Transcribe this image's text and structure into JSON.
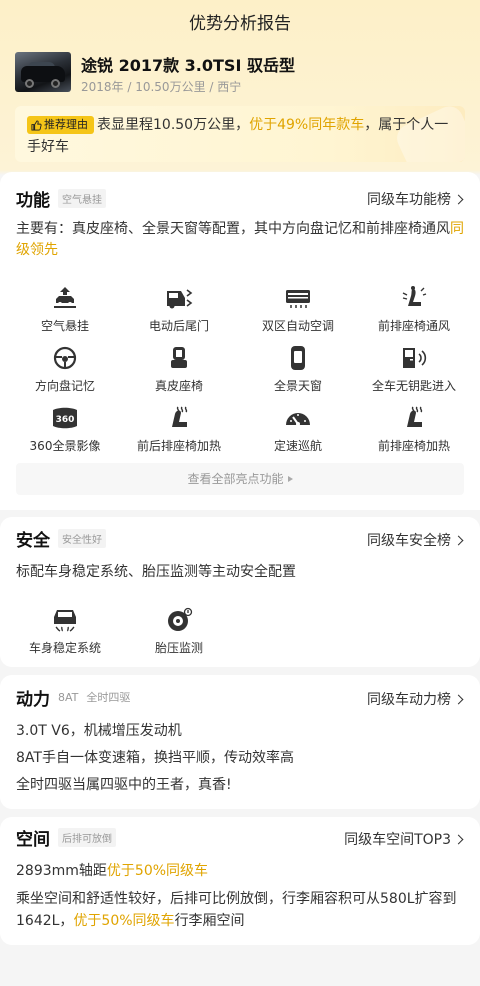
{
  "header": {
    "title": "优势分析报告"
  },
  "car": {
    "name": "途锐 2017款 3.0TSI 驭岳型",
    "meta": "2018年 / 10.50万公里 / 西宁"
  },
  "recommend": {
    "badge": "推荐理由",
    "text_1": "表显里程10.50万公里，",
    "text_hl": "优于49%同年款车",
    "text_2": "，属于个人一手好车"
  },
  "function_section": {
    "title": "功能",
    "tag": "空气悬挂",
    "rank": "同级车功能榜",
    "desc_1": "主要有：真皮座椅、全景天窗等配置，其中方向盘记忆和前排座椅通风",
    "desc_hl": "同级领先",
    "features": [
      {
        "label": "空气悬挂",
        "icon": "air-suspension-icon"
      },
      {
        "label": "电动后尾门",
        "icon": "power-tailgate-icon"
      },
      {
        "label": "双区自动空调",
        "icon": "dual-zone-ac-icon"
      },
      {
        "label": "前排座椅通风",
        "icon": "seat-ventilation-icon"
      },
      {
        "label": "方向盘记忆",
        "icon": "steering-memory-icon"
      },
      {
        "label": "真皮座椅",
        "icon": "leather-seat-icon"
      },
      {
        "label": "全景天窗",
        "icon": "panoramic-sunroof-icon"
      },
      {
        "label": "全车无钥匙进入",
        "icon": "keyless-entry-icon"
      },
      {
        "label": "360全景影像",
        "icon": "camera-360-icon"
      },
      {
        "label": "前后排座椅加热",
        "icon": "seat-heating-front-rear-icon"
      },
      {
        "label": "定速巡航",
        "icon": "cruise-control-icon"
      },
      {
        "label": "前排座椅加热",
        "icon": "seat-heating-front-icon"
      }
    ],
    "more": "查看全部亮点功能"
  },
  "safety_section": {
    "title": "安全",
    "tag": "安全性好",
    "rank": "同级车安全榜",
    "desc": "标配车身稳定系统、胎压监测等主动安全配置",
    "features": [
      {
        "label": "车身稳定系统",
        "icon": "stability-control-icon"
      },
      {
        "label": "胎压监测",
        "icon": "tire-pressure-icon"
      }
    ]
  },
  "power_section": {
    "title": "动力",
    "tag_1": "8AT",
    "tag_2": "全时四驱",
    "rank": "同级车动力榜",
    "lines": [
      "3.0T V6，机械增压发动机",
      "8AT手自一体变速箱，换挡平顺，传动效率高",
      "全时四驱当属四驱中的王者，真香!"
    ]
  },
  "space_section": {
    "title": "空间",
    "tag": "后排可放倒",
    "rank": "同级车空间TOP3",
    "line1_a": "2893mm轴距",
    "line1_hl": "优于50%同级车",
    "line2_a": "乘坐空间和舒适性较好，后排可比例放倒，行李厢容积可从580L扩容到1642L，",
    "line2_hl": "优于50%同级车",
    "line2_b": "行李厢空间"
  },
  "colors": {
    "accent": "#e0a400",
    "badge": "#f5c518",
    "text": "#333333",
    "muted": "#999999"
  }
}
